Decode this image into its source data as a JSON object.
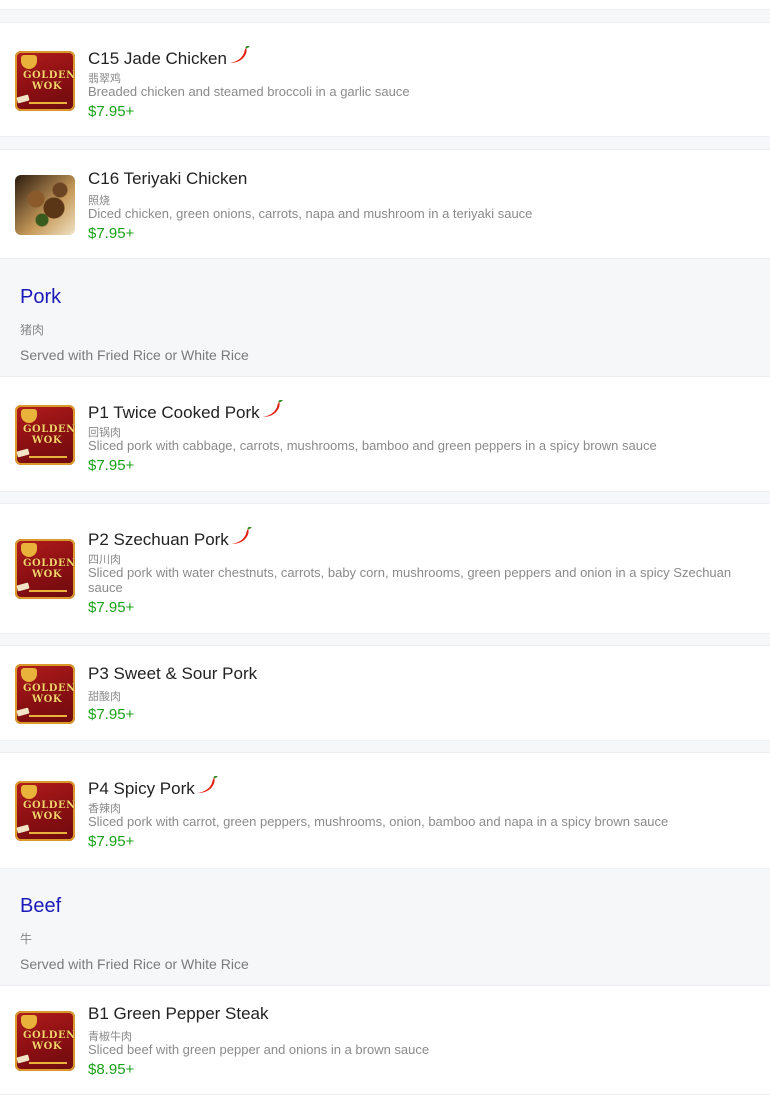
{
  "colors": {
    "price": "#1aa11a",
    "section_title": "#1a1ab8",
    "background": "#f6f7f9"
  },
  "items_top": [
    {
      "name": "C15 Jade Chicken",
      "spicy": true,
      "chinese": "翡翠鸡",
      "description": "Breaded chicken and steamed broccoli in a garlic sauce",
      "price": "$7.95+",
      "image": "golden-wok-logo"
    },
    {
      "name": "C16 Teriyaki Chicken",
      "spicy": false,
      "chinese": "照烧",
      "description": "Diced chicken, green onions, carrots, napa and mushroom in a teriyaki sauce",
      "price": "$7.95+",
      "image": "food-photo"
    }
  ],
  "sections": [
    {
      "title": "Pork",
      "chinese": "猪肉",
      "note": "Served with Fried Rice or White Rice",
      "items": [
        {
          "name": "P1 Twice Cooked Pork",
          "spicy": true,
          "chinese": "回锅肉",
          "description": "Sliced pork with cabbage, carrots, mushrooms, bamboo and green peppers in a spicy brown sauce",
          "price": "$7.95+"
        },
        {
          "name": "P2 Szechuan Pork",
          "spicy": true,
          "chinese": "四川肉",
          "description": "Sliced pork with water chestnuts, carrots, baby corn, mushrooms, green peppers and onion in a spicy Szechuan sauce",
          "price": "$7.95+"
        },
        {
          "name": "P3 Sweet & Sour Pork",
          "spicy": false,
          "chinese": "甜酸肉",
          "description": "",
          "price": "$7.95+"
        },
        {
          "name": "P4 Spicy Pork",
          "spicy": true,
          "chinese": "香辣肉",
          "description": "Sliced pork with carrot, green peppers, mushrooms, onion, bamboo and napa in a spicy brown sauce",
          "price": "$7.95+"
        }
      ]
    },
    {
      "title": "Beef",
      "chinese": "牛",
      "note": "Served with Fried Rice or White Rice",
      "items": [
        {
          "name": "B1 Green Pepper Steak",
          "spicy": false,
          "chinese": "青椒牛肉",
          "description": "Sliced beef with green pepper and onions in a brown sauce",
          "price": "$8.95+"
        }
      ]
    }
  ],
  "logo_text": [
    "GOLDEN",
    "WOK"
  ],
  "icons": {
    "spicy": "chili-pepper-icon"
  }
}
